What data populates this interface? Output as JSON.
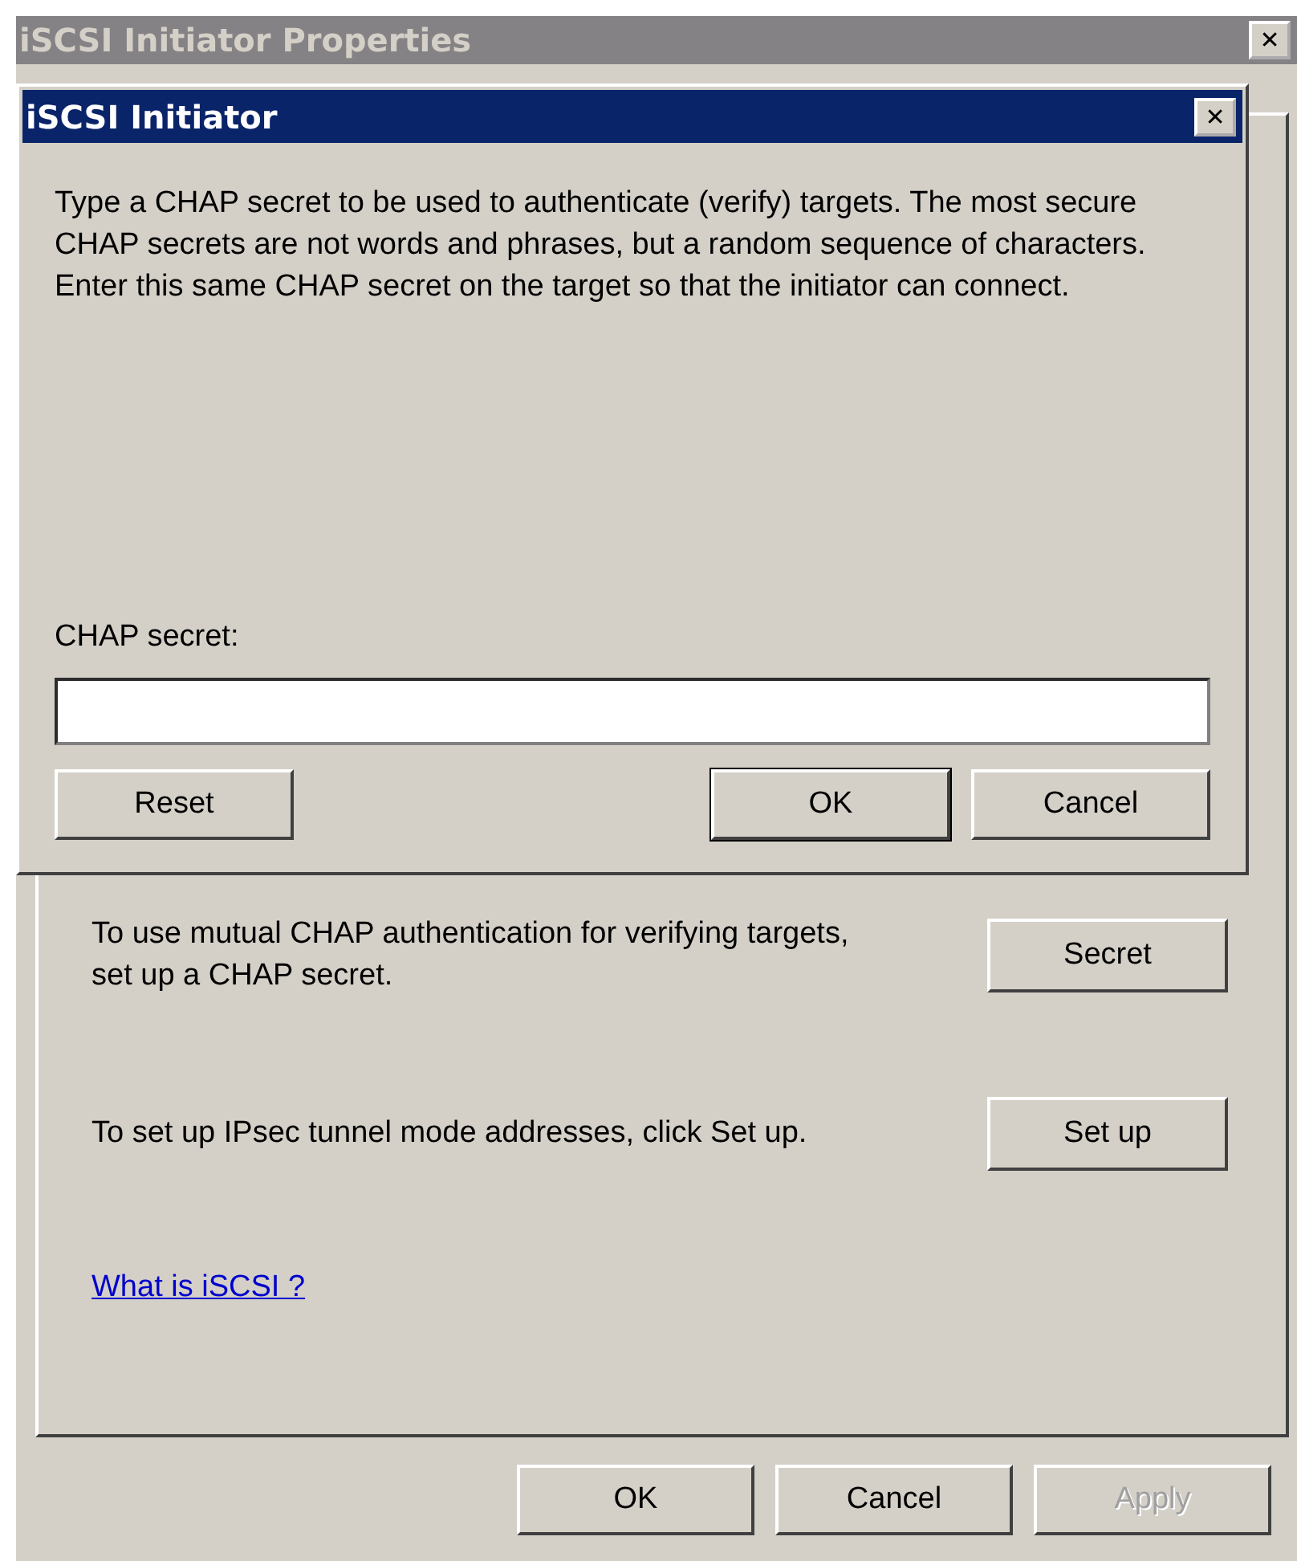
{
  "window": {
    "title": "iSCSI Initiator Properties",
    "close": "✕"
  },
  "rows": [
    {
      "text": "To use mutual CHAP authentication for verifying targets, set up a CHAP secret.",
      "button": "Secret"
    },
    {
      "text": "To set up IPsec tunnel mode addresses, click Set up.",
      "button": "Set up"
    }
  ],
  "link": "What is iSCSI ?",
  "buttons": [
    {
      "label": "OK",
      "disabled": false
    },
    {
      "label": "Cancel",
      "disabled": false
    },
    {
      "label": "Apply",
      "disabled": true
    }
  ],
  "dialog": {
    "title": "iSCSI Initiator",
    "close": "✕",
    "message": "Type a CHAP secret to be used to authenticate (verify) targets. The most secure CHAP secrets are not words and phrases, but a random sequence of characters. Enter this same CHAP secret on the target so that the initiator can connect.",
    "field_label": "CHAP secret:",
    "buttons": [
      {
        "label": "Reset",
        "default": false
      },
      {
        "label": "OK",
        "default": true
      },
      {
        "label": "Cancel",
        "default": false
      }
    ]
  }
}
